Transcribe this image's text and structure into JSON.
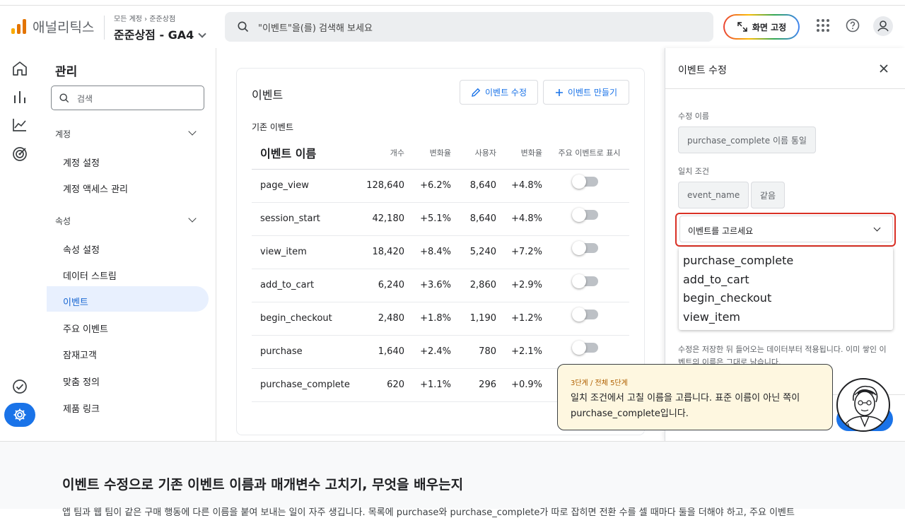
{
  "header": {
    "brand": "애널리틱스",
    "breadcrumb_account": "모든 계정",
    "breadcrumb_sep": "›",
    "breadcrumb_property": "준준상점",
    "property_name": "준준상점 - GA4",
    "search_placeholder": "\"이벤트\"을(를) 검색해 보세요",
    "pin_label": "화면 고정",
    "icons": [
      "apps-grid-icon",
      "help-icon",
      "account-icon"
    ],
    "logo_colors": [
      "#f9ab00",
      "#e37400",
      "#e37400"
    ]
  },
  "rail": {
    "icons": [
      "home-icon",
      "reports-icon",
      "explore-icon",
      "advertising-icon",
      "check-circle-icon",
      "gear-icon"
    ],
    "accent": "#1a73e8"
  },
  "nav": {
    "title": "관리",
    "search_placeholder": "검색",
    "sections": [
      {
        "label": "계정",
        "items": [
          "계정 설정",
          "계정 액세스 관리"
        ]
      },
      {
        "label": "속성",
        "items": [
          "속성 설정",
          "데이터 스트림",
          "이벤트",
          "주요 이벤트",
          "잠재고객",
          "맞춤 정의",
          "제품 링크"
        ]
      }
    ],
    "active_item": "이벤트"
  },
  "main": {
    "title": "이벤트",
    "edit_button": "이벤트 수정",
    "create_button": "이벤트 만들기",
    "subtitle": "기존 이벤트",
    "columns": [
      "이벤트 이름",
      "개수",
      "변화율",
      "사용자",
      "변화율",
      "주요 이벤트로 표시"
    ],
    "rows": [
      {
        "name": "page_view",
        "count": "128,640",
        "count_change": "+6.2%",
        "users": "8,640",
        "users_change": "+4.8%"
      },
      {
        "name": "session_start",
        "count": "42,180",
        "count_change": "+5.1%",
        "users": "8,640",
        "users_change": "+4.8%"
      },
      {
        "name": "view_item",
        "count": "18,420",
        "count_change": "+8.4%",
        "users": "5,240",
        "users_change": "+7.2%"
      },
      {
        "name": "add_to_cart",
        "count": "6,240",
        "count_change": "+3.6%",
        "users": "2,860",
        "users_change": "+2.9%"
      },
      {
        "name": "begin_checkout",
        "count": "2,480",
        "count_change": "+1.8%",
        "users": "1,190",
        "users_change": "+1.2%"
      },
      {
        "name": "purchase",
        "count": "1,640",
        "count_change": "+2.4%",
        "users": "780",
        "users_change": "+2.1%"
      },
      {
        "name": "purchase_complete",
        "count": "620",
        "count_change": "+1.1%",
        "users": "296",
        "users_change": "+0.9%"
      }
    ]
  },
  "panel": {
    "title": "이벤트 수정",
    "edit_name_label": "수정 이름",
    "edit_name_value": "purchase_complete 이름 통일",
    "match_label": "일치 조건",
    "match_param": "event_name",
    "match_operator": "같음",
    "select_placeholder": "이벤트를 고르세요",
    "options": [
      "purchase_complete",
      "add_to_cart",
      "begin_checkout",
      "view_item"
    ],
    "note": "수정은 저장한 뒤 들어오는 데이터부터 적용됩니다. 이미 쌓인 이벤트의 이름은 그대로 남습니다.",
    "highlight_color": "#d93025"
  },
  "tooltip": {
    "step": "3단계 / 전체 5단계",
    "text": "일치 조건에서 고칠 이름을 고릅니다. 표준 이름이 아닌 쪽이 purchase_complete입니다."
  },
  "article": {
    "title": "이벤트 수정으로 기존 이벤트 이름과 매개변수 고치기, 무엇을 배우는지",
    "body": "앱 팀과 웹 팀이 같은 구매 행동에 다른 이름을 붙여 보내는 일이 자주 생깁니다. 목록에 purchase와 purchase_complete가 따로 잡히면 전환 수를 셀 때마다 둘을 더해야 하고, 주요 이벤트"
  }
}
